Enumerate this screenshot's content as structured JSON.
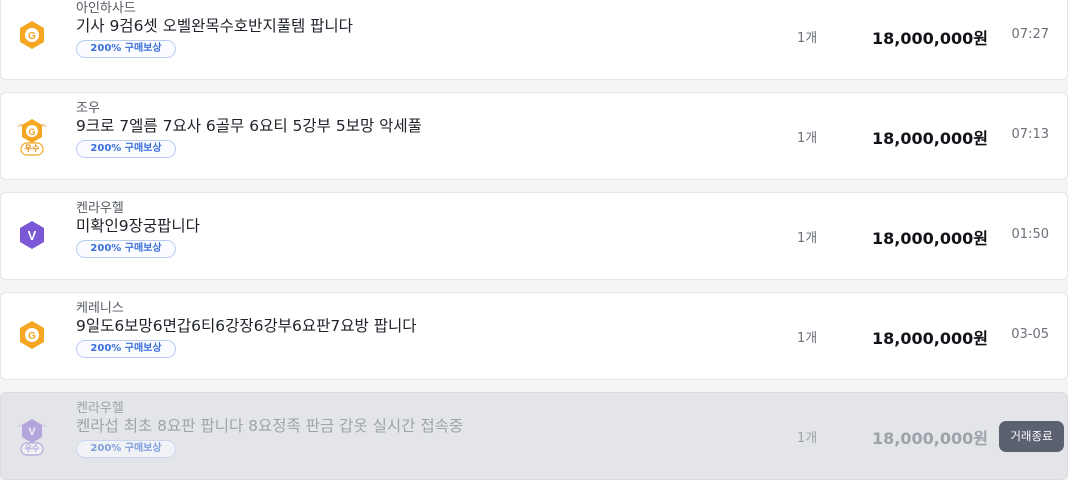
{
  "listings": [
    {
      "server": "아인하사드",
      "title": "기사 9검6셋 오벨완목수호반지풀템 팝니다",
      "badge": "200% 구매보상",
      "qty": "1개",
      "price": "18,000,000원",
      "time": "07:27",
      "grade": "gold",
      "grade_label": ""
    },
    {
      "server": "조우",
      "title": "9크로 7엘름 7요사 6골무 6요티 5강부 5보망 악세풀",
      "badge": "200% 구매보상",
      "qty": "1개",
      "price": "18,000,000원",
      "time": "07:13",
      "grade": "gold-excellent",
      "grade_label": "우수"
    },
    {
      "server": "켄라우헬",
      "title": "미확인9장궁팝니다",
      "badge": "200% 구매보상",
      "qty": "1개",
      "price": "18,000,000원",
      "time": "01:50",
      "grade": "purple",
      "grade_label": ""
    },
    {
      "server": "케레니스",
      "title": "9일도6보망6면갑6티6강장6강부6요판7요방 팝니다",
      "badge": "200% 구매보상",
      "qty": "1개",
      "price": "18,000,000원",
      "time": "03-05",
      "grade": "gold",
      "grade_label": ""
    },
    {
      "server": "켄라우헬",
      "title": "켄라섭 최초 8요판 팝니다 8요정족 판금 갑옷 실시간 접속중",
      "badge": "200% 구매보상",
      "qty": "1개",
      "price": "18,000,000원",
      "status_button": "거래종료",
      "grade": "purple-excellent",
      "grade_label": "우수"
    }
  ],
  "colors": {
    "gold": "#f5a623",
    "purple": "#7b58d6",
    "badge_text": "#3b6fd9",
    "closed_bg": "#e4e5e8"
  }
}
